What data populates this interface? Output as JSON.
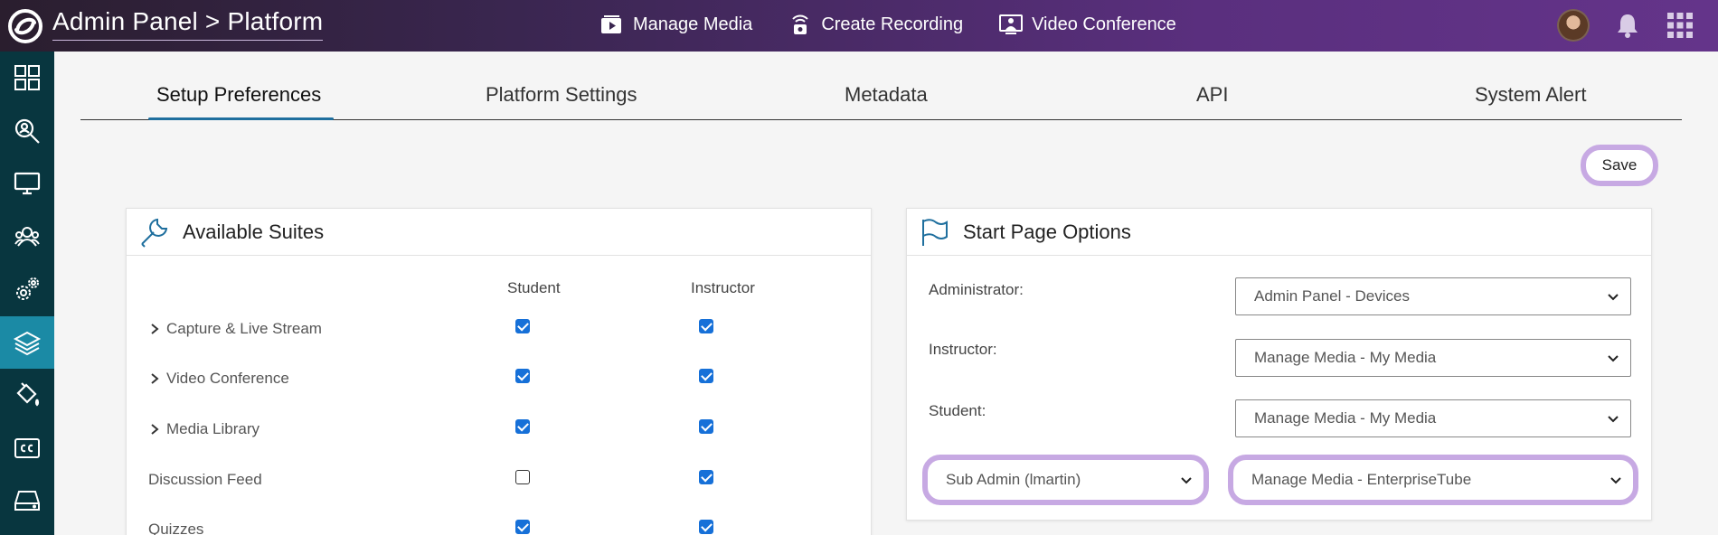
{
  "header": {
    "breadcrumb": "Admin Panel > Platform",
    "nav": [
      {
        "label": "Manage Media",
        "icon": "media-icon"
      },
      {
        "label": "Create Recording",
        "icon": "recording-icon"
      },
      {
        "label": "Video Conference",
        "icon": "conference-icon"
      }
    ]
  },
  "sidebar": {
    "items": [
      {
        "icon": "dashboard-icon",
        "active": false
      },
      {
        "icon": "search-icon",
        "active": false
      },
      {
        "icon": "monitor-icon",
        "active": false
      },
      {
        "icon": "users-icon",
        "active": false
      },
      {
        "icon": "settings-icon",
        "active": false
      },
      {
        "icon": "layers-icon",
        "active": true
      },
      {
        "icon": "paint-bucket-icon",
        "active": false
      },
      {
        "icon": "closed-caption-icon",
        "active": false
      },
      {
        "icon": "storage-icon",
        "active": false
      }
    ]
  },
  "tabs": [
    "Setup Preferences",
    "Platform Settings",
    "Metadata",
    "API",
    "System Alert"
  ],
  "active_tab": "Setup Preferences",
  "save_label": "Save",
  "suites": {
    "title": "Available Suites",
    "columns": [
      "Student",
      "Instructor"
    ],
    "rows": [
      {
        "label": "Capture & Live Stream",
        "expandable": true,
        "student": true,
        "instructor": true
      },
      {
        "label": "Video Conference",
        "expandable": true,
        "student": true,
        "instructor": true
      },
      {
        "label": "Media Library",
        "expandable": true,
        "student": true,
        "instructor": true
      },
      {
        "label": "Discussion Feed",
        "expandable": false,
        "student": false,
        "instructor": true
      },
      {
        "label": "Quizzes",
        "expandable": false,
        "student": true,
        "instructor": true
      }
    ]
  },
  "start_page": {
    "title": "Start Page Options",
    "rows": [
      {
        "label": "Administrator:",
        "value": "Admin Panel - Devices"
      },
      {
        "label": "Instructor:",
        "value": "Manage Media - My Media"
      },
      {
        "label": "Student:",
        "value": "Manage Media - My Media"
      }
    ],
    "sub_admin_select": "Sub Admin (lmartin)",
    "sub_admin_value": "Manage Media - EnterpriseTube"
  },
  "colors": {
    "sidebar": "#08363f",
    "sidebar_active": "#1b8aa5",
    "highlight": "#c7a9e3",
    "accent": "#1f6f9e"
  }
}
